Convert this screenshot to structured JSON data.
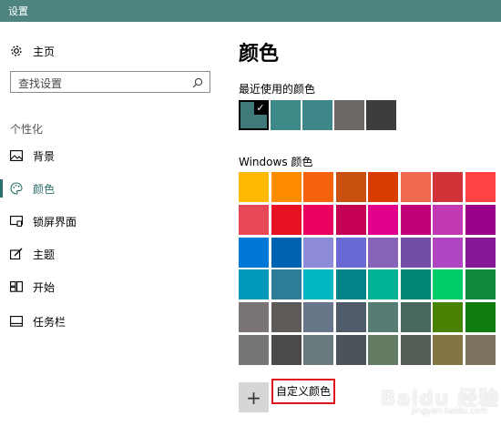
{
  "window": {
    "title": "设置"
  },
  "sidebar": {
    "home": {
      "label": "主页",
      "icon": "gear-icon"
    },
    "search": {
      "placeholder": "查找设置",
      "icon": "search-icon"
    },
    "section_label": "个性化",
    "items": [
      {
        "label": "背景",
        "icon": "picture-icon",
        "active": false
      },
      {
        "label": "颜色",
        "icon": "palette-icon",
        "active": true
      },
      {
        "label": "锁屏界面",
        "icon": "lock-screen-icon",
        "active": false
      },
      {
        "label": "主题",
        "icon": "theme-brush-icon",
        "active": false
      },
      {
        "label": "开始",
        "icon": "start-menu-icon",
        "active": false
      },
      {
        "label": "任务栏",
        "icon": "taskbar-icon",
        "active": false
      }
    ],
    "accent_color": "#2b6f6a"
  },
  "main": {
    "title": "颜色",
    "recent_title": "最近使用的颜色",
    "recent_colors": [
      "#3f7a78",
      "#3d8a88",
      "#3e8788",
      "#6b6866",
      "#3d3d3d"
    ],
    "recent_selected_index": 0,
    "windows_title": "Windows 颜色",
    "windows_colors": [
      [
        "#ffb900",
        "#ff8c00",
        "#f7630c",
        "#ca5010",
        "#da3b01",
        "#ef6950",
        "#d13438",
        "#ff4343"
      ],
      [
        "#e74856",
        "#e81123",
        "#ea005e",
        "#c30052",
        "#e3008c",
        "#bf0077",
        "#c239b3",
        "#9a0089"
      ],
      [
        "#0078d7",
        "#0063b1",
        "#8e8cd8",
        "#6b69d6",
        "#8764b8",
        "#744da9",
        "#b146c2",
        "#881798"
      ],
      [
        "#0099bc",
        "#2d7d9a",
        "#00b7c3",
        "#038387",
        "#00b294",
        "#018574",
        "#00cc6a",
        "#10893e"
      ],
      [
        "#7a7574",
        "#5d5a58",
        "#68768a",
        "#515c6b",
        "#567c73",
        "#486860",
        "#498205",
        "#107c10"
      ],
      [
        "#767676",
        "#4c4a48",
        "#69797e",
        "#4a5459",
        "#647c64",
        "#525e54",
        "#847545",
        "#7e735f"
      ]
    ],
    "custom_button_symbol": "+",
    "custom_label": "自定义颜色"
  },
  "watermark": {
    "text": "Baidu 经验",
    "sub": "jingyan.baidu.com"
  }
}
